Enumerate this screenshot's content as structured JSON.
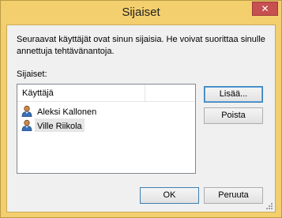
{
  "window": {
    "title": "Sijaiset",
    "close_glyph": "✕"
  },
  "dialog": {
    "description": "Seuraavat käyttäjät ovat sinun sijaisia. He voivat suorittaa sinulle annettuja tehtävänantoja.",
    "list_caption": "Sijaiset:",
    "list": {
      "column_header": "Käyttäjä",
      "rows": [
        {
          "label": "Aleksi Kallonen",
          "icon": "user-icon",
          "selected": false
        },
        {
          "label": "Ville Riikola",
          "icon": "user-icon",
          "selected": true
        }
      ]
    },
    "buttons": {
      "add_label": "Lisää...",
      "remove_label": "Poista",
      "ok_label": "OK",
      "cancel_label": "Peruuta"
    }
  },
  "colors": {
    "title_bar": "#f3cf6d",
    "close_button": "#c75050",
    "client_bg": "#f0f0f0",
    "selection_bg": "#e6e6e6"
  }
}
